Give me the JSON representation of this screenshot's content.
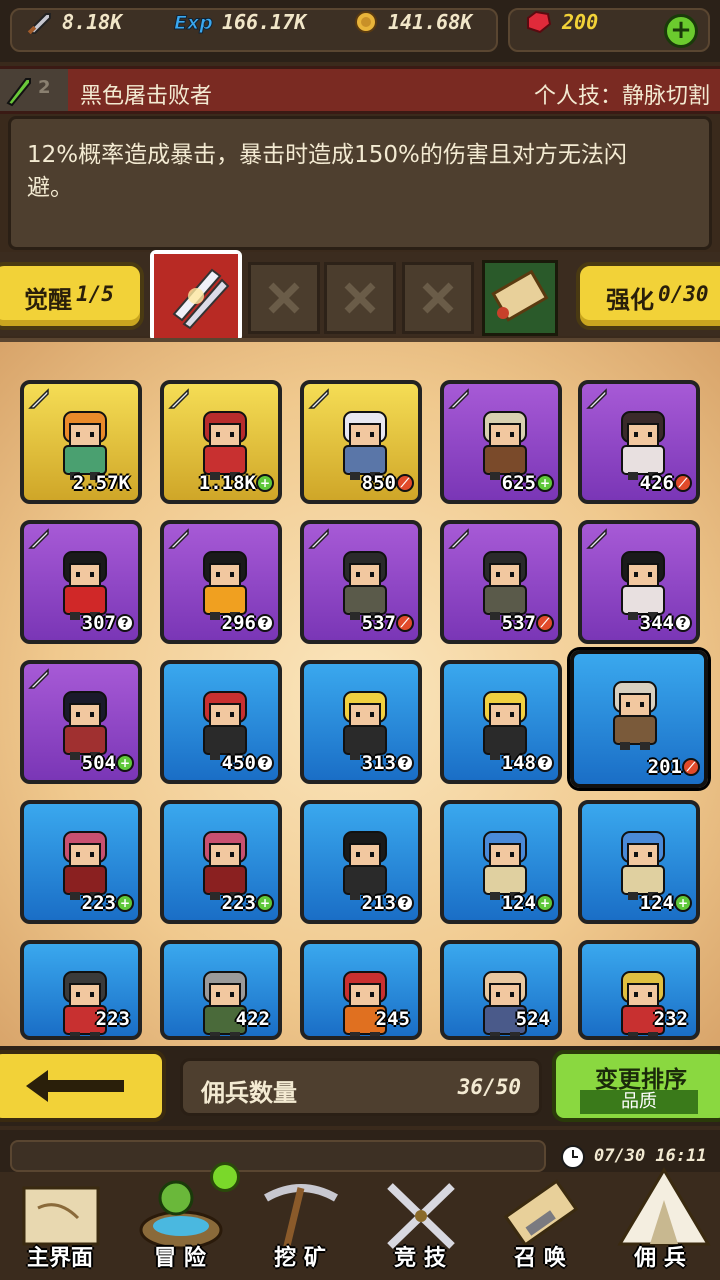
{
  "resources": {
    "attack": "8.18K",
    "exp": "166.17K",
    "gold": "141.68K",
    "gems": "200",
    "exp_icon_label": "Exp"
  },
  "skill": {
    "level": "2",
    "name": "黑色屠击败者",
    "personal_skill": "个人技：静脉切割",
    "description_line1": "12%概率造成暴击，暴击时造成150%的伤害且对方无法闪",
    "description_line2": "避。"
  },
  "awaken": {
    "label": "觉醒",
    "count": "1/5"
  },
  "enhance": {
    "label": "强化",
    "count": "0/30"
  },
  "mercenaries": [
    {
      "value": "2.57K",
      "rarity": "gold",
      "badge": "",
      "hair": "#e98a2a",
      "shirt": "#4aa070"
    },
    {
      "value": "1.18K",
      "rarity": "gold",
      "badge": "plus",
      "hair": "#b82c2c",
      "shirt": "#c83030"
    },
    {
      "value": "850",
      "rarity": "gold",
      "badge": "up",
      "hair": "#e8e8f0",
      "shirt": "#5a76a8"
    },
    {
      "value": "625",
      "rarity": "purple",
      "badge": "plus",
      "hair": "#d8d0b0",
      "shirt": "#7a4a2a"
    },
    {
      "value": "426",
      "rarity": "purple",
      "badge": "up",
      "hair": "#3a2a2a",
      "shirt": "#e8e0e0"
    },
    {
      "value": "307",
      "rarity": "purple",
      "badge": "q",
      "hair": "#1a1a1a",
      "shirt": "#d02828"
    },
    {
      "value": "296",
      "rarity": "purple",
      "badge": "q",
      "hair": "#1a1a1a",
      "shirt": "#f0a020"
    },
    {
      "value": "537",
      "rarity": "purple",
      "badge": "up",
      "hair": "#2a2a2a",
      "shirt": "#5a5a4a"
    },
    {
      "value": "537",
      "rarity": "purple",
      "badge": "up",
      "hair": "#2a2a2a",
      "shirt": "#5a5a4a"
    },
    {
      "value": "344",
      "rarity": "purple",
      "badge": "q",
      "hair": "#1a1a1a",
      "shirt": "#e8e0e0"
    },
    {
      "value": "504",
      "rarity": "purple",
      "badge": "plus",
      "hair": "#1a1a2a",
      "shirt": "#a03030"
    },
    {
      "value": "450",
      "rarity": "blue",
      "badge": "q",
      "hair": "#c83030",
      "shirt": "#2a2a2a"
    },
    {
      "value": "313",
      "rarity": "blue",
      "badge": "q",
      "hair": "#f0d040",
      "shirt": "#2a2a2a"
    },
    {
      "value": "148",
      "rarity": "blue",
      "badge": "q",
      "hair": "#f0d040",
      "shirt": "#2a2a2a"
    },
    {
      "value": "201",
      "rarity": "blue",
      "badge": "up",
      "hair": "#d8d0c0",
      "shirt": "#7a5a3a"
    },
    {
      "value": "223",
      "rarity": "blue",
      "badge": "plus",
      "hair": "#c85070",
      "shirt": "#8a2020"
    },
    {
      "value": "223",
      "rarity": "blue",
      "badge": "plus",
      "hair": "#c85070",
      "shirt": "#8a2020"
    },
    {
      "value": "213",
      "rarity": "blue",
      "badge": "q",
      "hair": "#1a1a1a",
      "shirt": "#2a2a2a"
    },
    {
      "value": "124",
      "rarity": "blue",
      "badge": "plus",
      "hair": "#4a8ad8",
      "shirt": "#e0d0a0"
    },
    {
      "value": "124",
      "rarity": "blue",
      "badge": "plus",
      "hair": "#4a8ad8",
      "shirt": "#e0d0a0"
    },
    {
      "value": "223",
      "rarity": "blue",
      "badge": "",
      "hair": "#3a3a3a",
      "shirt": "#c83030"
    },
    {
      "value": "422",
      "rarity": "blue",
      "badge": "",
      "hair": "#9a9a9a",
      "shirt": "#4a6a3a"
    },
    {
      "value": "245",
      "rarity": "blue",
      "badge": "",
      "hair": "#c83030",
      "shirt": "#e07020"
    },
    {
      "value": "524",
      "rarity": "blue",
      "badge": "",
      "hair": "#e8c8a0",
      "shirt": "#4a5a8a"
    },
    {
      "value": "232",
      "rarity": "blue",
      "badge": "",
      "hair": "#e0c040",
      "shirt": "#c83030"
    }
  ],
  "action": {
    "back_label": "←",
    "count_label": "佣兵数量",
    "count_value": "36/50",
    "sort_label": "变更排序",
    "sort_sub": "品质"
  },
  "status": {
    "time": "07/30 16:11"
  },
  "nav": {
    "home": "主界面",
    "adventure": "冒 险",
    "mine": "挖 矿",
    "arena": "竞 技",
    "summon": "召 唤",
    "mercenary": "佣 兵"
  },
  "colors": {
    "gold": "#f2d238",
    "green": "#6bcb2e",
    "purple": "#8a44c4",
    "blue": "#2a8ee0"
  }
}
